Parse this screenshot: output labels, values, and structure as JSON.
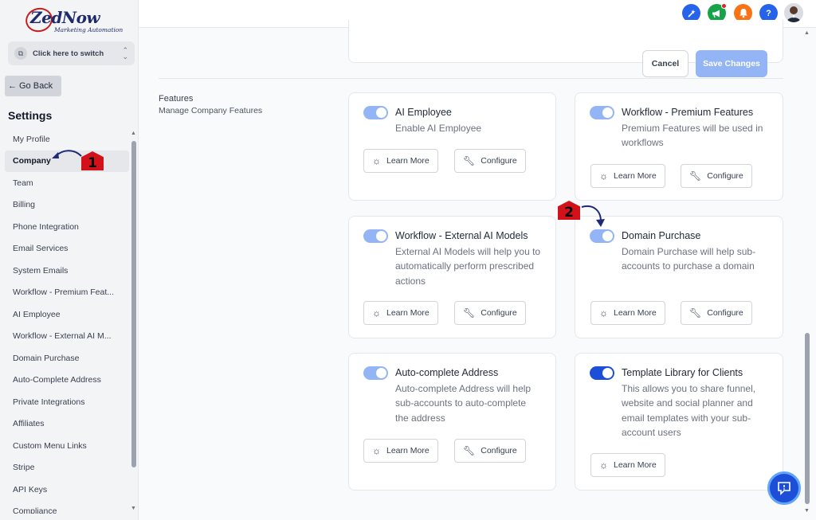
{
  "brand": {
    "logo_text": "ZedNow",
    "logo_sub": "Marketing Automation"
  },
  "switcher": {
    "label": "Click here to switch"
  },
  "sidebar": {
    "go_back": "Go Back",
    "title": "Settings",
    "items": [
      {
        "label": "My Profile"
      },
      {
        "label": "Company"
      },
      {
        "label": "Team"
      },
      {
        "label": "Billing"
      },
      {
        "label": "Phone Integration"
      },
      {
        "label": "Email Services"
      },
      {
        "label": "System Emails"
      },
      {
        "label": "Workflow - Premium Feat..."
      },
      {
        "label": "AI Employee"
      },
      {
        "label": "Workflow - External AI M..."
      },
      {
        "label": "Domain Purchase"
      },
      {
        "label": "Auto-Complete Address"
      },
      {
        "label": "Private Integrations"
      },
      {
        "label": "Affiliates"
      },
      {
        "label": "Custom Menu Links"
      },
      {
        "label": "Stripe"
      },
      {
        "label": "API Keys"
      },
      {
        "label": "Compliance"
      }
    ],
    "active": "Company"
  },
  "header": {
    "icons": [
      {
        "name": "magic-icon",
        "color": "#2563eb"
      },
      {
        "name": "megaphone-icon",
        "color": "#16a34a"
      },
      {
        "name": "bell-icon",
        "color": "#f97316"
      },
      {
        "name": "help-icon",
        "color": "#2563eb",
        "glyph": "?"
      }
    ]
  },
  "actions": {
    "cancel": "Cancel",
    "save": "Save Changes"
  },
  "features": {
    "title": "Features",
    "subtitle": "Manage Company Features",
    "learn_more": "Learn More",
    "configure": "Configure",
    "cards": [
      {
        "title": "AI Employee",
        "desc": "Enable AI Employee",
        "enabled": true
      },
      {
        "title": "Workflow - Premium Features",
        "desc": "Premium Features will be used in workflows",
        "enabled": true
      },
      {
        "title": "Workflow - External AI Models",
        "desc": "External AI Models will help you to automatically perform prescribed actions",
        "enabled": true
      },
      {
        "title": "Domain Purchase",
        "desc": "Domain Purchase will help sub-accounts to purchase a domain",
        "enabled": true
      },
      {
        "title": "Auto-complete Address",
        "desc": "Auto-complete Address will help sub-accounts to auto-complete the address",
        "enabled": true
      },
      {
        "title": "Template Library for Clients",
        "desc": "This allows you to share funnel, website and social planner and email templates with your sub-account users",
        "enabled": true
      }
    ]
  },
  "markers": {
    "one": "1",
    "two": "2"
  }
}
